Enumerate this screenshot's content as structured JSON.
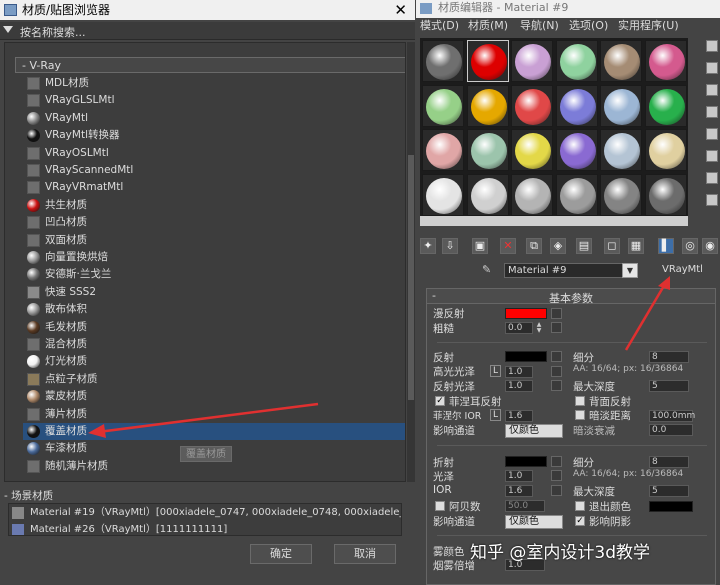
{
  "browser": {
    "title": "材质/贴图浏览器",
    "close": "✕",
    "search_placeholder": "按名称搜索...",
    "group_vray": "- V-Ray",
    "items": [
      {
        "label": "MDL材质",
        "swatch": "#6e6e6e",
        "ball": false
      },
      {
        "label": "VRayGLSLMtl",
        "swatch": "#6e6e6e",
        "ball": false
      },
      {
        "label": "VRayMtl",
        "swatch": "#8a8a8a",
        "ball": true
      },
      {
        "label": "VRayMtl转换器",
        "swatch": "#111111",
        "ball": true
      },
      {
        "label": "VRayOSLMtl",
        "swatch": "#6e6e6e",
        "ball": false
      },
      {
        "label": "VRayScannedMtl",
        "swatch": "#6e6e6e",
        "ball": false
      },
      {
        "label": "VRayVRmatMtl",
        "swatch": "#6e6e6e",
        "ball": false
      },
      {
        "label": "共生材质",
        "swatch": "#cc1111",
        "ball": true
      },
      {
        "label": "凹凸材质",
        "swatch": "#6e6e6e",
        "ball": false
      },
      {
        "label": "双面材质",
        "swatch": "#6e6e6e",
        "ball": false
      },
      {
        "label": "向量置换烘焙",
        "swatch": "#9a9a9a",
        "ball": true
      },
      {
        "label": "安德斯·兰戈兰",
        "swatch": "#777777",
        "ball": true
      },
      {
        "label": "快速 SSS2",
        "swatch": "#8a8a8a",
        "ball": false
      },
      {
        "label": "散布体积",
        "swatch": "#999999",
        "ball": true
      },
      {
        "label": "毛发材质",
        "swatch": "#5a3a22",
        "ball": true
      },
      {
        "label": "混合材质",
        "swatch": "#6e6e6e",
        "ball": false
      },
      {
        "label": "灯光材质",
        "swatch": "#f2f2f2",
        "ball": true
      },
      {
        "label": "点粒子材质",
        "swatch": "#8a7a5a",
        "ball": false
      },
      {
        "label": "蒙皮材质",
        "swatch": "#b08a6a",
        "ball": true
      },
      {
        "label": "薄片材质",
        "swatch": "#6e6e6e",
        "ball": false
      },
      {
        "label": "覆盖材质",
        "swatch": "#111111",
        "ball": true,
        "selected": true
      },
      {
        "label": "车漆材质",
        "swatch": "#4a6a9a",
        "ball": true
      },
      {
        "label": "随机薄片材质",
        "swatch": "#6e6e6e",
        "ball": false
      }
    ],
    "tooltip": "覆盖材质",
    "scene_header": "- 场景材质",
    "scene_rows": [
      "Material #19（VRayMtl）[000xiadele_0747, 000xiadele_0748, 000xiadele_0749...",
      "Material #26（VRayMtl）[1111111111]"
    ],
    "ok": "确定",
    "cancel": "取消"
  },
  "editor": {
    "title": "材质编辑器 - Material #9",
    "menu": [
      "模式(D)",
      "材质(M)",
      "导航(N)",
      "选项(O)",
      "实用程序(U)"
    ],
    "slot_colors": [
      "#6f6f6f",
      "#dd0000",
      "#c9a0d4",
      "#8fd29f",
      "#a58c74",
      "#d45a8e",
      "#96d088",
      "#e5a800",
      "#e04848",
      "#7c7cd8",
      "#9cb6d4",
      "#28b04c",
      "#e0a6a6",
      "#9cc4ac",
      "#e3d848",
      "#8a6ad2",
      "#b4c4d4",
      "#e0d0a0",
      "#e4e4e4",
      "#d0d0d0",
      "#b4b4b4",
      "#9c9c9c",
      "#848484",
      "#6c6c6c"
    ],
    "material_name": "Material #9",
    "material_type": "VRayMtl",
    "panel_title": "基本参数",
    "panel_minus": "-",
    "diffuse": "漫反射",
    "roughness": "粗糙",
    "roughness_val": "0.0",
    "reflect": "反射",
    "subdiv": "细分",
    "subdiv_val": "8",
    "hilight_gloss": "高光光泽",
    "hilight_l": "L",
    "hilight_val": "1.0",
    "aa_text": "AA: 16/64; px: 16/36864",
    "refl_gloss": "反射光泽",
    "refl_gloss_val": "1.0",
    "max_depth": "最大深度",
    "max_depth_val": "5",
    "fresnel": "菲涅耳反射",
    "back_reflect": "背面反射",
    "fresnel_ior": "菲涅尔 IOR",
    "fresnel_l": "L",
    "fresnel_ior_val": "1.6",
    "dim_distance": "暗淡距离",
    "dim_distance_val": "100.0mm",
    "affect_ch": "影响通道",
    "affect_ch_val": "仅颜色",
    "dim_falloff": "暗淡衰减",
    "dim_falloff_val": "0.0",
    "refract": "折射",
    "refr_subdiv": "细分",
    "refr_subdiv_val": "8",
    "refr_aa": "AA: 16/64; px: 16/36864",
    "gloss": "光泽",
    "gloss_val": "1.0",
    "ior": "IOR",
    "ior_val": "1.6",
    "refr_max_depth": "最大深度",
    "refr_max_depth_val": "5",
    "abbe": "阿贝数",
    "abbe_val": "50.0",
    "exit_color": "退出颜色",
    "affect_ch2": "影响通道",
    "affect_ch2_val": "仅颜色",
    "affect_shadow": "影响阴影",
    "fog_color": "雾颜色",
    "fog_mult": "烟雾倍增",
    "fog_mult_val": "1.0"
  },
  "watermark": "知乎 @室内设计3d教学",
  "colors": {
    "diffuse": "#ff0000",
    "reflect": "#000000",
    "refract": "#000000",
    "exit": "#000000",
    "selection": "#28507f",
    "arrow": "#e03030"
  }
}
